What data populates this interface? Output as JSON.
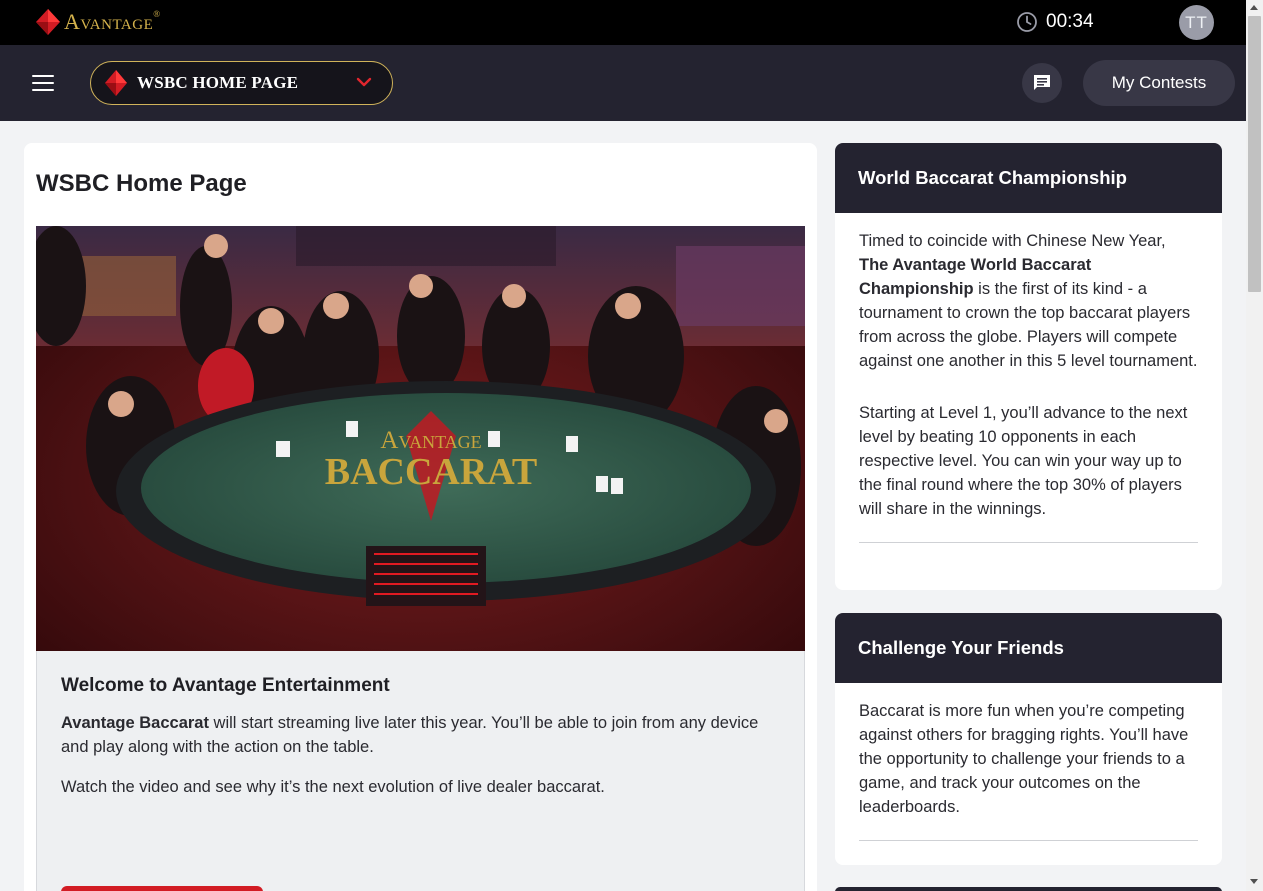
{
  "brand": {
    "name": "Avantage",
    "trademark": "®"
  },
  "topbar": {
    "timer": "00:34",
    "avatar_initials": "TT"
  },
  "nav": {
    "selected_page": "WSBC HOME PAGE",
    "my_contests_label": "My Contests"
  },
  "main": {
    "title": "WSBC Home Page",
    "hero": {
      "table_logo_line1": "Avantage",
      "table_logo_line2": "BACCARAT"
    },
    "welcome": {
      "heading": "Welcome to Avantage Entertainment",
      "p1_bold": "Avantage Baccarat",
      "p1_rest": " will start streaming live later this year. You’ll be able to join from any device  and play along with the action on the table.",
      "p2": "Watch the video and see why it’s the next evolution of live dealer baccarat."
    }
  },
  "sidebar": {
    "championship": {
      "title": "World Baccarat Championship",
      "p1_pre": "Timed to coincide with Chinese New Year, ",
      "p1_bold": "The Avantage World Baccarat Championship",
      "p1_post": " is the first of its kind - a tournament to crown the top baccarat players from across the globe. Players will compete against one another in this 5 level tournament.",
      "p2": "Starting at Level 1, you’ll advance to the next level by beating 10 opponents in each respective level. You can win your way up to the final round where the top 30% of players will share in the winnings."
    },
    "challenge": {
      "title": "Challenge Your Friends",
      "p1": "Baccarat is more fun when you’re competing against others for bragging rights. You’ll have the opportunity to challenge your friends to a game, and track your outcomes on the leaderboards."
    }
  },
  "colors": {
    "topbar_bg": "#000000",
    "navbar_bg": "#242330",
    "brand_gold": "#d4b24c",
    "brand_red": "#d21c24",
    "page_bg": "#f2f3f5"
  },
  "icons": [
    "logo-diamond-icon",
    "clock-icon",
    "menu-icon",
    "diamond-icon",
    "chevron-down-icon",
    "chat-icon"
  ]
}
